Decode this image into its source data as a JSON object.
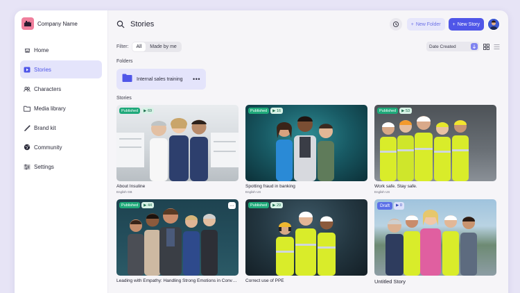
{
  "brand": {
    "name": "Company Name"
  },
  "sidebar": {
    "items": [
      {
        "label": "Home",
        "icon": "home-icon"
      },
      {
        "label": "Stories",
        "icon": "play-icon",
        "active": true
      },
      {
        "label": "Characters",
        "icon": "people-icon"
      },
      {
        "label": "Media library",
        "icon": "folder-icon"
      },
      {
        "label": "Brand kit",
        "icon": "brush-icon"
      },
      {
        "label": "Community",
        "icon": "globe-icon"
      },
      {
        "label": "Settings",
        "icon": "sliders-icon"
      }
    ]
  },
  "header": {
    "title": "Stories",
    "new_folder_label": "New Folder",
    "new_story_label": "New Story"
  },
  "filter": {
    "label": "Filter:",
    "options": [
      "All",
      "Made by me"
    ],
    "selected": "All",
    "sort_label": "Date Created"
  },
  "folders": {
    "heading": "Folders",
    "items": [
      {
        "name": "Internal sales training"
      }
    ]
  },
  "stories": {
    "heading": "Stories",
    "items": [
      {
        "title": "About Insuline",
        "lang": "English GB",
        "status": "Published",
        "views": "69"
      },
      {
        "title": "Spotting fraud in banking",
        "lang": "English US",
        "status": "Published",
        "views": "16"
      },
      {
        "title": "Work safe. Stay safe.",
        "lang": "English US",
        "status": "Published",
        "views": "53"
      },
      {
        "title": "Leading with Empathy: Handling Strong Emotions in Convers...",
        "lang": "",
        "status": "Published",
        "views": "44"
      },
      {
        "title": "Correct use of PPE",
        "lang": "",
        "status": "Published",
        "views": "29"
      },
      {
        "title": "Untitled Story",
        "lang": "",
        "status": "Draft",
        "views": "0"
      }
    ]
  },
  "colors": {
    "accent": "#4f56e8",
    "published": "#1fa97a",
    "draft": "#5b70e8",
    "background": "#e7e4f6"
  }
}
